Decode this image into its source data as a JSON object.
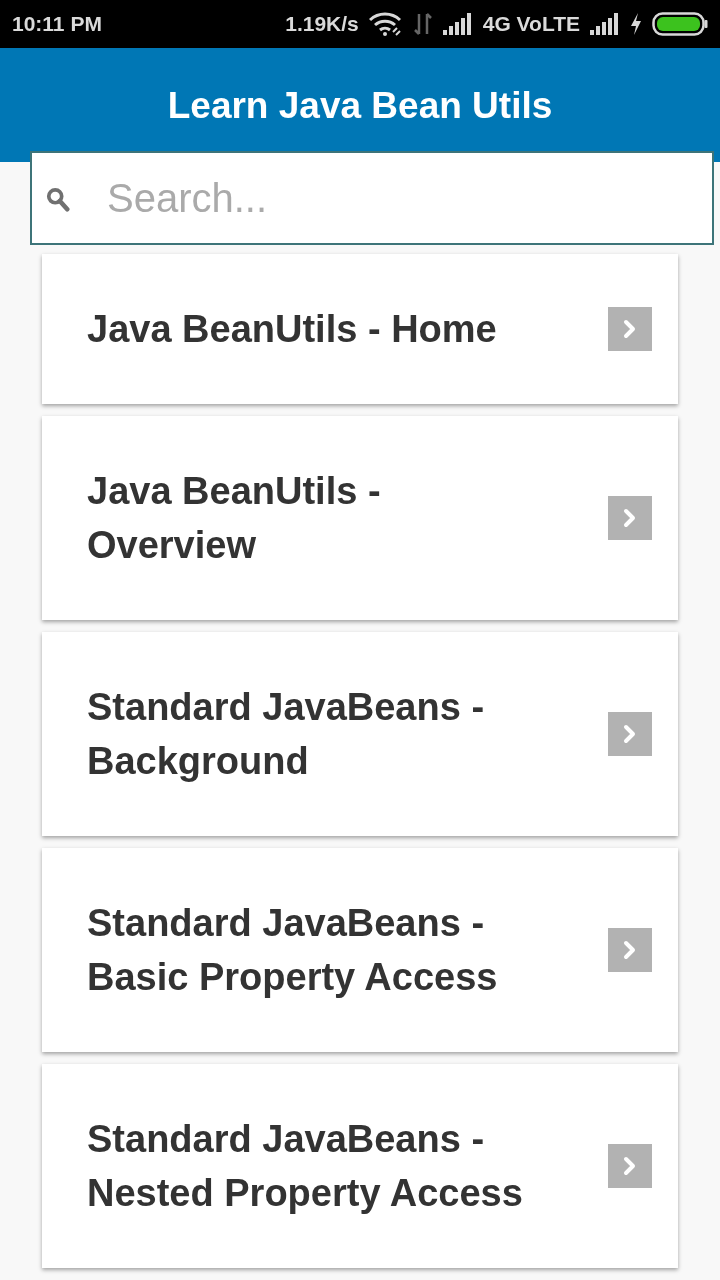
{
  "status_bar": {
    "time": "10:11 PM",
    "network_speed": "1.19K/s",
    "network_type": "4G VoLTE"
  },
  "app_bar": {
    "title": "Learn Java Bean Utils"
  },
  "search": {
    "placeholder": "Search..."
  },
  "topics": [
    "Java BeanUtils - Home",
    "Java BeanUtils - Overview",
    "Standard JavaBeans - Background",
    "Standard JavaBeans - Basic Property Access",
    "Standard JavaBeans - Nested Property Access"
  ]
}
